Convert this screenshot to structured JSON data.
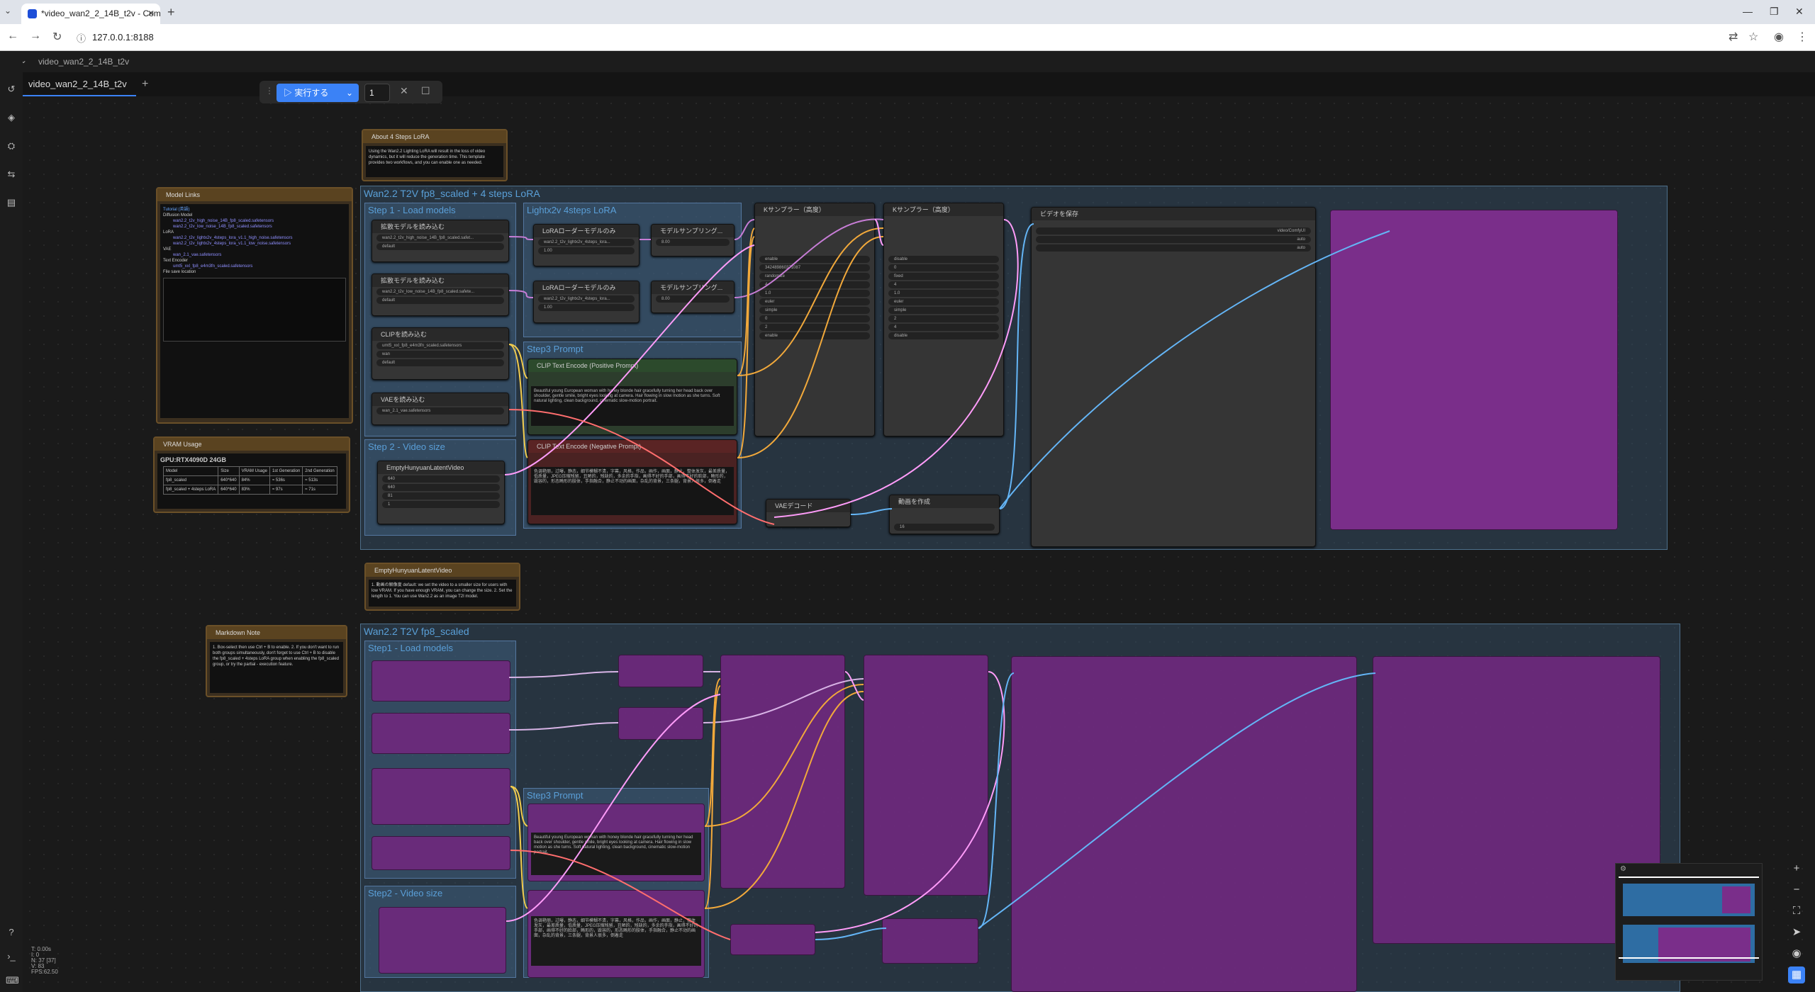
{
  "browser": {
    "tab_title": "*video_wan2_2_14B_t2v - Comfy",
    "url": "127.0.0.1:8188"
  },
  "app": {
    "workflow_menu": "video_wan2_2_14B_t2v",
    "workflow_tab": "video_wan2_2_14B_t2v",
    "run_label": "実行する",
    "run_count": "1"
  },
  "notes": {
    "about_lora": {
      "title": "About 4 Steps LoRA",
      "text": "Using the Wan2.2 Lighting LoRA will result in the loss of video dynamics, but it will reduce the generation time. This template provides two workflows, and you can enable one as needed."
    },
    "model_links": {
      "title": "Model Links",
      "heading": "Tutorial (英語)",
      "diffusion": "Diffusion Model",
      "d1": "wan2.2_t2v_high_noise_14B_fp8_scaled.safetensors",
      "d2": "wan2.2_t2v_low_noise_14B_fp8_scaled.safetensors",
      "lora": "LoRA",
      "l1": "wan2.2_t2v_lightx2v_4steps_lora_v1.1_high_noise.safetensors",
      "l2": "wan2.2_t2v_lightx2v_4steps_lora_v1.1_low_noise.safetensors",
      "vae": "VAE",
      "v1": "wan_2.1_vae.safetensors",
      "te": "Text Encoder",
      "t1": "umt5_xxl_fp8_e4m3fn_scaled.safetensors",
      "fsl": "File save location"
    },
    "vram": {
      "title": "VRAM Usage",
      "gpu": "GPU:RTX4090D 24GB",
      "headers": [
        "Model",
        "Size",
        "VRAM Usage",
        "1st Generation",
        "2nd Generation"
      ],
      "row1": [
        "fp8_scaled",
        "640*640",
        "84%",
        "≈ 536s",
        "≈ 513s"
      ],
      "row2": [
        "fp8_scaled + 4steps LoRA",
        "640*640",
        "83%",
        "≈ 97s",
        "≈ 71s"
      ]
    },
    "empty_latent": {
      "title": "EmptyHunyuanLatentVideo",
      "text": "1. 動画の解像度 default: we set the video to a smaller size for users with low VRAM. If you have enough VRAM, you can change the size. 2. Set the length to 1. You can use Wan2.2 as an image T2I model."
    },
    "markdown": {
      "title": "Markdown Note",
      "text": "1. Box-select then use Ctrl + B to enable. 2. If you don't want to run both groups simultaneously, don't forget to use Ctrl + B to disable the fp8_scaled + 4steps LoRA group when enabling the fp8_scaled group, or try the partial - execution feature."
    }
  },
  "group1": {
    "title": "Wan2.2 T2V fp8_scaled + 4 steps LoRA",
    "step1": "Step 1 - Load models",
    "lightx": "Lightx2v 4steps LoRA",
    "step3": "Step3 Prompt",
    "step2": "Step 2 - Video size",
    "unet1": {
      "title": "拡散モデルを読み込む",
      "name": "wan2.2_t2v_high_noise_14B_fp8_scaled.safet...",
      "dtype": "default"
    },
    "unet2": {
      "title": "拡散モデルを読み込む",
      "name": "wan2.2_t2v_low_noise_14B_fp8_scaled.safete...",
      "dtype": "default"
    },
    "clip": {
      "title": "CLIPを読み込む",
      "name": "umt5_xxl_fp8_e4m3fn_scaled.safetensors",
      "type": "wan",
      "device": "default"
    },
    "vae": {
      "title": "VAEを読み込む",
      "name": "wan_2.1_vae.safetensors"
    },
    "lora1": {
      "title": "LoRAローダーモデルのみ",
      "name": "wan2.2_t2v_lightx2v_4steps_lora...",
      "strength": "1.00"
    },
    "lora2": {
      "title": "LoRAローダーモデルのみ",
      "name": "wan2.2_t2v_lightx2v_4steps_lora...",
      "strength": "1.00"
    },
    "ms1": {
      "title": "モデルサンプリング...",
      "shift": "8.00"
    },
    "ms2": {
      "title": "モデルサンプリング...",
      "shift": "8.00"
    },
    "pos": {
      "title": "CLIP Text Encode (Positive Prompt)",
      "text": "Beautiful young European woman with honey blonde hair gracefully turning her head back over shoulder, gentle smile, bright eyes looking at camera. Hair flowing in slow motion as she turns. Soft natural lighting, clean background, cinematic slow-motion portrait."
    },
    "neg": {
      "title": "CLIP Text Encode (Negative Prompt)",
      "text": "色调艳丽，过曝，静态，细节模糊不清，字幕，风格，作品，画作，画面，静止，整体发灰，最差质量，低质量，JPEG压缩残留，丑陋的，残缺的，多余的手指，画得不好的手部，画得不好的脸部，畸形的，毁容的，形态畸形的肢体，手指融合，静止不动的画面，杂乱的背景，三条腿，背景人很多，倒着走"
    },
    "latent": {
      "title": "EmptyHunyuanLatentVideo",
      "w": "640",
      "h": "640",
      "len": "81",
      "batch": "1"
    },
    "ks1": {
      "title": "Kサンプラー（高度）",
      "noise": "enable",
      "seed": "342489860371087",
      "ctrl": "randomize",
      "steps": "4",
      "cfg": "1.0",
      "sampler": "euler",
      "sched": "simple",
      "start": "0",
      "end": "2",
      "ret": "enable"
    },
    "ks2": {
      "title": "Kサンプラー（高度）",
      "noise": "disable",
      "seed": "0",
      "ctrl": "fixed",
      "steps": "4",
      "cfg": "1.0",
      "sampler": "euler",
      "sched": "simple",
      "start": "2",
      "end": "4",
      "ret": "disable"
    },
    "vaedec": "VAEデコード",
    "createvid": {
      "title": "動画を作成",
      "fps": "16"
    },
    "savevid": {
      "title": "ビデオを保存",
      "prefix": "video/ComfyUI",
      "format": "auto",
      "codec": "auto"
    }
  },
  "group2": {
    "title": "Wan2.2 T2V fp8_scaled",
    "step1": "Step1 - Load models",
    "step3": "Step3 Prompt",
    "step2": "Step2 - Video size"
  },
  "stats": [
    "T: 0.00s",
    "I: 0",
    "N: 37 [37]",
    "V: 83",
    "FPS:62.50"
  ]
}
